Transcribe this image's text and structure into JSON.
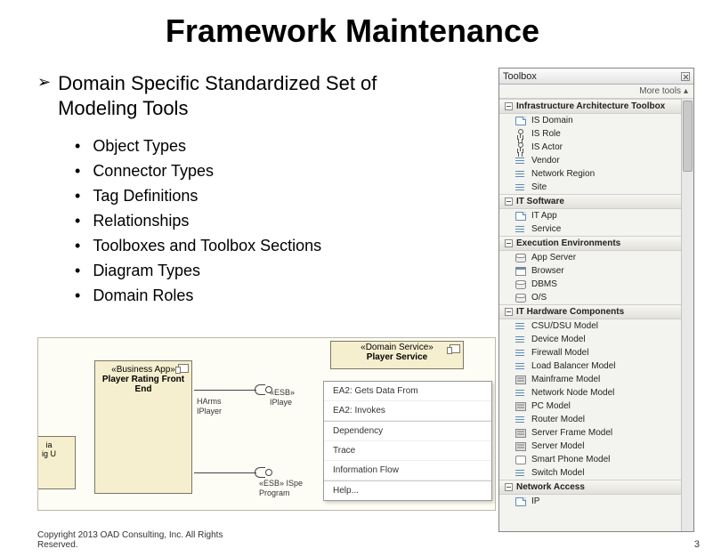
{
  "title": "Framework Maintenance",
  "main_bullet": "Domain Specific Standardized Set of Modeling Tools",
  "sub_bullets": [
    "Object Types",
    "Connector Types",
    "Tag Definitions",
    "Relationships",
    "Toolboxes and Toolbox Sections",
    "Diagram Types",
    "Domain Roles"
  ],
  "diagram": {
    "partial_box_lines": [
      "ia",
      "ig U"
    ],
    "app_box_stereotype": "«Business App»",
    "app_box_name": "Player Rating Front End",
    "domain_box_stereotype": "«Domain Service»",
    "domain_box_name": "Player Service",
    "iface_arms_label": "HArms",
    "iface_player_label": "IPlayer",
    "iface_esb1": "«ESB»",
    "iface_esb1_name": "IPlaye",
    "iface_esb2": "«ESB» ISpe",
    "iface_esb2_name": "Program"
  },
  "context_menu": [
    "EA2: Gets Data From",
    "EA2: Invokes",
    "Dependency",
    "Trace",
    "Information Flow",
    "Help..."
  ],
  "toolbox": {
    "title": "Toolbox",
    "moretools": "More tools",
    "sections": [
      {
        "name": "Infrastructure Architecture Toolbox",
        "items": [
          {
            "icon": "page",
            "label": "IS Domain"
          },
          {
            "icon": "actor",
            "label": "IS Role"
          },
          {
            "icon": "actor",
            "label": "IS Actor"
          },
          {
            "icon": "bars",
            "label": "Vendor"
          },
          {
            "icon": "bars",
            "label": "Network Region"
          },
          {
            "icon": "bars",
            "label": "Site"
          }
        ]
      },
      {
        "name": "IT Software",
        "items": [
          {
            "icon": "page",
            "label": "IT App"
          },
          {
            "icon": "bars",
            "label": "Service"
          }
        ]
      },
      {
        "name": "Execution Environments",
        "items": [
          {
            "icon": "db",
            "label": "App Server"
          },
          {
            "icon": "window",
            "label": "Browser"
          },
          {
            "icon": "db",
            "label": "DBMS"
          },
          {
            "icon": "db",
            "label": "O/S"
          }
        ]
      },
      {
        "name": "IT Hardware Components",
        "items": [
          {
            "icon": "bars",
            "label": "CSU/DSU Model"
          },
          {
            "icon": "bars",
            "label": "Device Model"
          },
          {
            "icon": "bars",
            "label": "Firewall Model"
          },
          {
            "icon": "bars",
            "label": "Load Balancer Model"
          },
          {
            "icon": "rack",
            "label": "Mainframe Model"
          },
          {
            "icon": "bars",
            "label": "Network Node Model"
          },
          {
            "icon": "rack",
            "label": "PC Model"
          },
          {
            "icon": "bars",
            "label": "Router Model"
          },
          {
            "icon": "rack",
            "label": "Server Frame Model"
          },
          {
            "icon": "rack",
            "label": "Server Model"
          },
          {
            "icon": "mobile",
            "label": "Smart Phone Model"
          },
          {
            "icon": "bars",
            "label": "Switch Model"
          }
        ]
      },
      {
        "name": "Network Access",
        "items": [
          {
            "icon": "page",
            "label": "IP"
          }
        ]
      }
    ]
  },
  "footer_line1": "Copyright 2013 OAD Consulting, Inc. All Rights",
  "footer_line2": "Reserved.",
  "slide_number": "3"
}
